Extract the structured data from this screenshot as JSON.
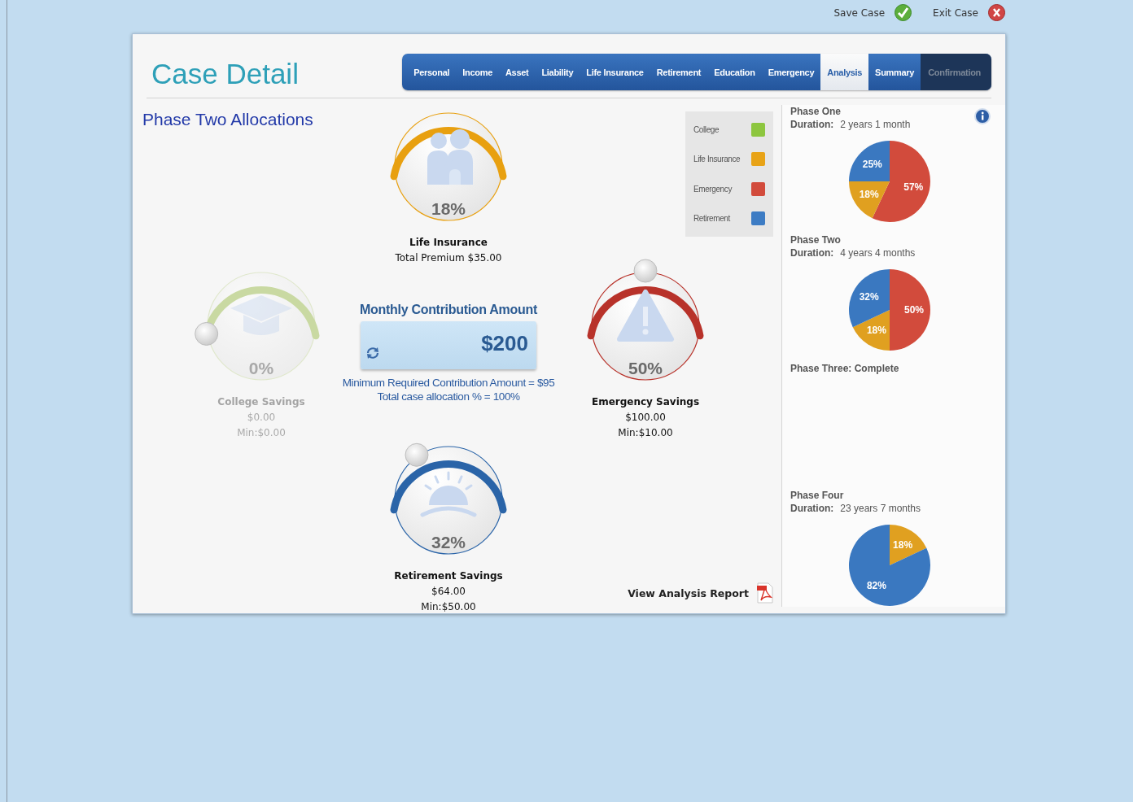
{
  "top_actions": [
    {
      "label": "Save Case",
      "kind": "save"
    },
    {
      "label": "Exit Case",
      "kind": "exit"
    }
  ],
  "header": {
    "title": "Case Detail"
  },
  "tabs": [
    {
      "label": "Personal",
      "selected": false,
      "disabled": false
    },
    {
      "label": "Income",
      "selected": false,
      "disabled": false
    },
    {
      "label": "Asset",
      "selected": false,
      "disabled": false
    },
    {
      "label": "Liability",
      "selected": false,
      "disabled": false
    },
    {
      "label": "Life Insurance",
      "selected": false,
      "disabled": false
    },
    {
      "label": "Retirement",
      "selected": false,
      "disabled": false
    },
    {
      "label": "Education",
      "selected": false,
      "disabled": false
    },
    {
      "label": "Emergency",
      "selected": false,
      "disabled": false
    },
    {
      "label": "Analysis",
      "selected": true,
      "disabled": false
    },
    {
      "label": "Summary",
      "selected": false,
      "disabled": false
    },
    {
      "label": "Confirmation",
      "selected": false,
      "disabled": true
    }
  ],
  "allocations": {
    "title": "Phase Two Allocations",
    "legend": [
      {
        "label": "College",
        "color": "#8dc63f"
      },
      {
        "label": "Life Insurance",
        "color": "#e8a317"
      },
      {
        "label": "Emergency",
        "color": "#d24b3c"
      },
      {
        "label": "Retirement",
        "color": "#3d7cc4"
      }
    ],
    "dials": [
      {
        "kind": "premium",
        "name": "Life Insurance",
        "percent": "18%",
        "lines": [
          "Total Premium $35.00"
        ],
        "color": "#e8a010",
        "disabled": false
      },
      {
        "kind": "slider",
        "name": "College Savings",
        "percent": "0%",
        "lines": [
          "$0.00",
          "Min:$0.00"
        ],
        "color": "#c9d9a2",
        "disabled": true
      },
      {
        "kind": "slider",
        "name": "Emergency Savings",
        "percent": "50%",
        "lines": [
          "$100.00",
          "Min:$10.00"
        ],
        "color": "#b8322a",
        "disabled": false
      },
      {
        "kind": "slider",
        "name": "Retirement Savings",
        "percent": "32%",
        "lines": [
          "$64.00",
          "Min:$50.00"
        ],
        "color": "#2a64a8",
        "disabled": false
      }
    ],
    "contribution": {
      "title": "Monthly Contribution Amount",
      "value": "$200",
      "notes": [
        "Minimum Required Contribution Amount = $95",
        "Total case allocation % = 100%"
      ]
    },
    "report_link": "View Analysis Report"
  },
  "phases": [
    {
      "kind": "pie",
      "title": "Phase One",
      "duration_label": "Duration:",
      "duration": "2 years 1 month",
      "chart_data": {
        "type": "pie",
        "colors": [
          "#d24b3c",
          "#e0a020",
          "#3a78c0"
        ],
        "values": [
          57,
          18,
          25
        ],
        "value_labels": [
          "57%",
          "18%",
          "25%"
        ]
      }
    },
    {
      "kind": "pie",
      "title": "Phase Two",
      "duration_label": "Duration:",
      "duration": "4 years 4 months",
      "chart_data": {
        "type": "pie",
        "colors": [
          "#d24b3c",
          "#e0a020",
          "#3a78c0"
        ],
        "values": [
          50,
          18,
          32
        ],
        "value_labels": [
          "50%",
          "18%",
          "32%"
        ]
      }
    },
    {
      "kind": "complete",
      "title": "Phase Three: Complete"
    },
    {
      "kind": "pie",
      "title": "Phase Four",
      "duration_label": "Duration:",
      "duration": "23 years 7 months",
      "chart_data": {
        "type": "pie",
        "colors": [
          "#e0a020",
          "#3a78c0"
        ],
        "values": [
          18,
          82
        ],
        "value_labels": [
          "18%",
          "82%"
        ]
      }
    }
  ]
}
